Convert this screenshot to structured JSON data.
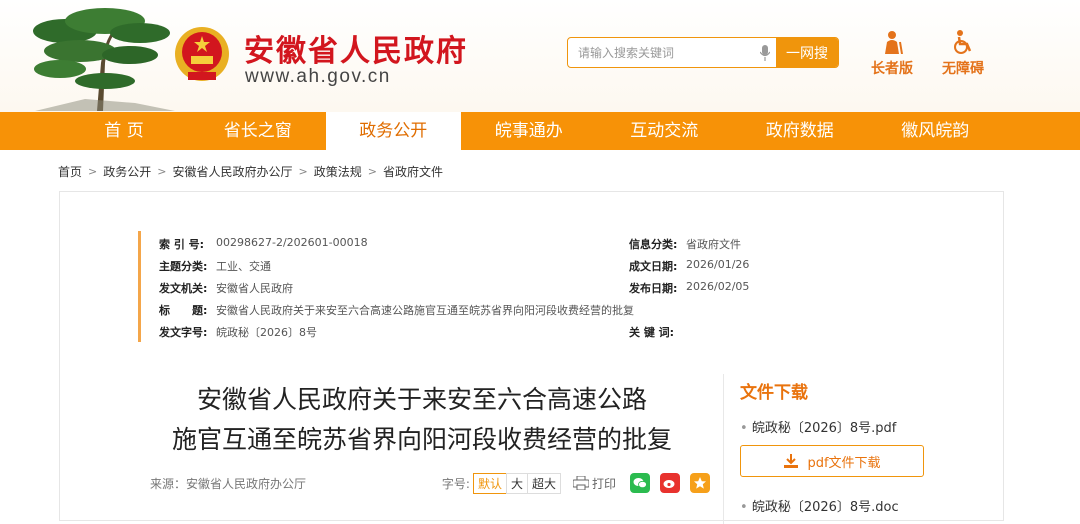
{
  "header": {
    "site_name": "安徽省人民政府",
    "site_url": "www.ah.gov.cn",
    "search_placeholder": "请输入搜索关键词",
    "search_button": "一网搜",
    "tool_elder": "长者版",
    "tool_accessible": "无障碍"
  },
  "nav": [
    "首 页",
    "省长之窗",
    "政务公开",
    "皖事通办",
    "互动交流",
    "政府数据",
    "徽风皖韵"
  ],
  "nav_active_index": 2,
  "breadcrumb": [
    "首页",
    "政务公开",
    "安徽省人民政府办公厅",
    "政策法规",
    "省政府文件"
  ],
  "meta": {
    "index_label": "索 引 号:",
    "index_value": "00298627-2/202601-00018",
    "topic_label": "主题分类:",
    "topic_value": "工业、交通",
    "issuer_label": "发文机关:",
    "issuer_value": "安徽省人民政府",
    "title_label": "标　　题:",
    "title_value": "安徽省人民政府关于来安至六合高速公路施官互通至皖苏省界向阳河段收费经营的批复",
    "docno_label": "发文字号:",
    "docno_value": "皖政秘〔2026〕8号",
    "category_label": "信息分类:",
    "category_value": "省政府文件",
    "created_label": "成文日期:",
    "created_value": "2026/01/26",
    "published_label": "发布日期:",
    "published_value": "2026/02/05",
    "keywords_label": "关 键 词:",
    "keywords_value": ""
  },
  "article": {
    "title_line1": "安徽省人民政府关于来安至六合高速公路",
    "title_line2": "施官互通至皖苏省界向阳河段收费经营的批复",
    "source": "来源：安徽省人民政府办公厅",
    "font_label": "字号:",
    "font_default": "默认",
    "font_large": "大",
    "font_xlarge": "超大",
    "print": "打印"
  },
  "downloads": {
    "title": "文件下载",
    "pdf_name": "皖政秘〔2026〕8号.pdf",
    "pdf_button": "pdf文件下载",
    "doc_name": "皖政秘〔2026〕8号.doc"
  },
  "colors": {
    "brand_orange": "#f79207",
    "title_red": "#d2161e"
  }
}
